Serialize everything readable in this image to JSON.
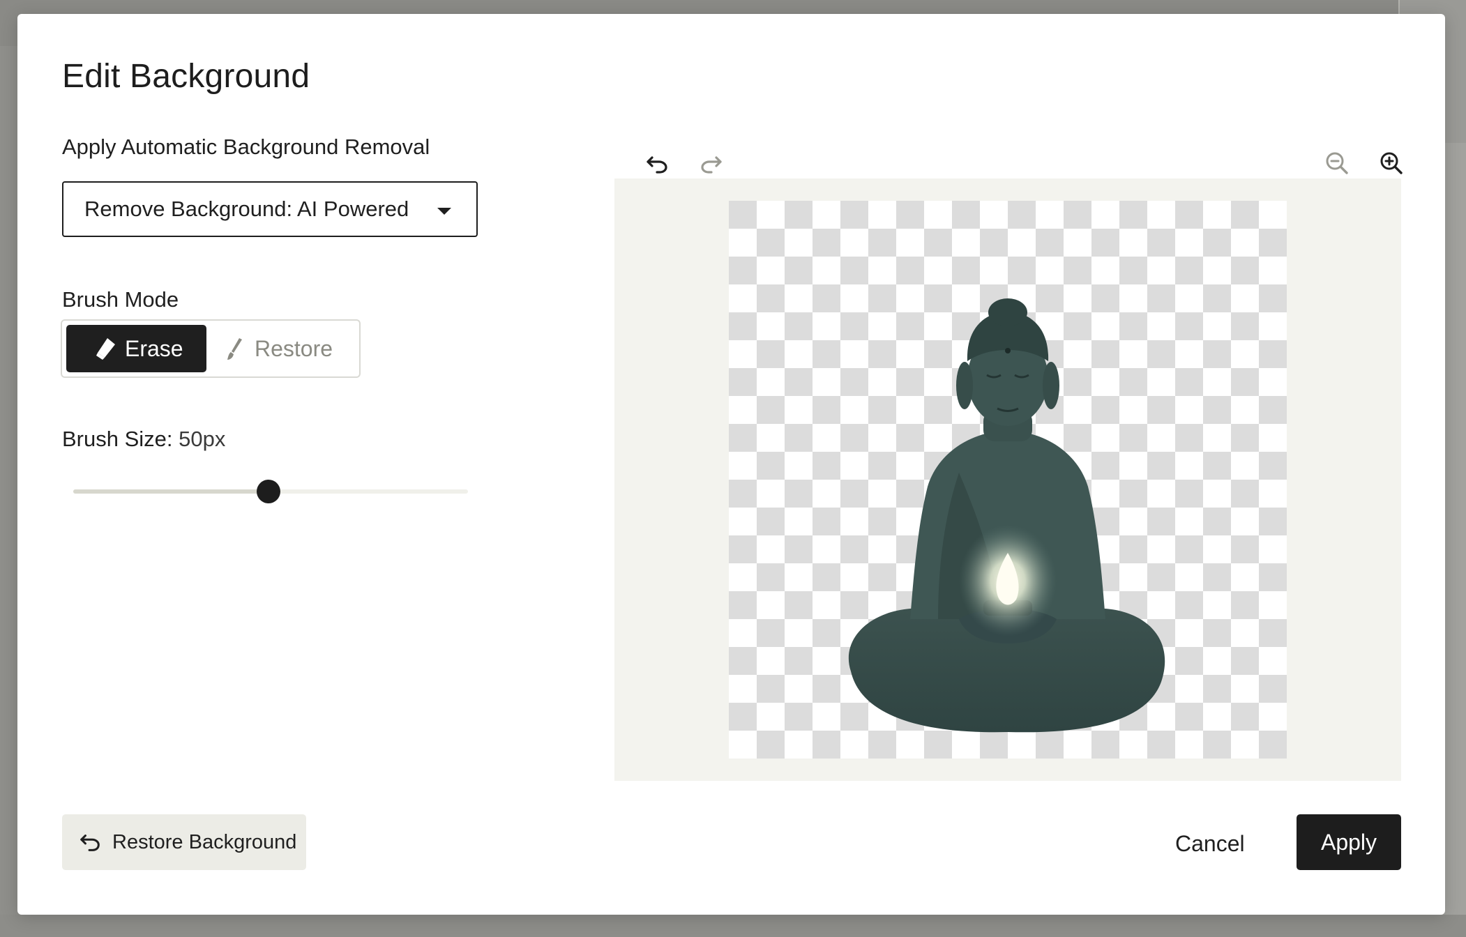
{
  "dialog": {
    "title": "Edit Background"
  },
  "auto_removal": {
    "label": "Apply Automatic Background Removal",
    "selected_option": "Remove Background: AI Powered"
  },
  "brush_mode": {
    "label": "Brush Mode",
    "options": [
      {
        "label": "Erase",
        "icon": "eraser-icon",
        "selected": true
      },
      {
        "label": "Restore",
        "icon": "brush-icon",
        "selected": false
      }
    ]
  },
  "brush_size": {
    "label": "Brush Size:",
    "value": "50px",
    "slider_fraction": 0.495
  },
  "toolbar": {
    "undo_icon": "undo-icon",
    "redo_icon": "redo-icon",
    "zoom_out_icon": "zoom-out-icon",
    "zoom_in_icon": "zoom-in-icon"
  },
  "footer": {
    "restore_background_label": "Restore Background",
    "cancel_label": "Cancel",
    "apply_label": "Apply"
  },
  "colors": {
    "primary_dark": "#1d1d1d",
    "canvas_bg": "#f3f3ee",
    "secondary_btn_bg": "#ecece6"
  }
}
